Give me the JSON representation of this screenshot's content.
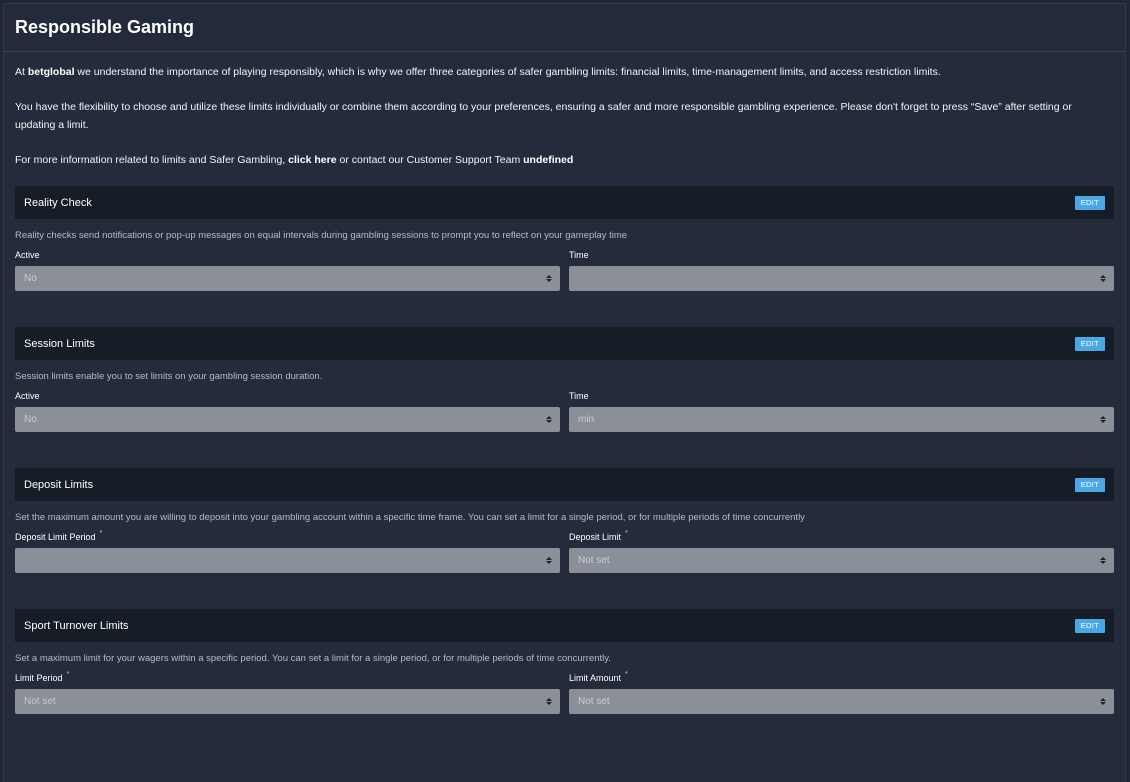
{
  "header": {
    "title": "Responsible Gaming"
  },
  "intro": {
    "p1_pre": "At ",
    "p1_brand": "betglobal",
    "p1_post": " we understand the importance of playing responsibly, which is why we offer three categories of safer gambling limits: financial limits, time-management limits, and access restriction limits.",
    "p2": "You have the flexibility to choose and utilize these limits individually or combine them according to your preferences, ensuring a safer and more responsible gambling experience. Please don't forget to press “Save” after setting or updating a limit.",
    "p3_pre": "For more information related to limits and Safer Gambling, ",
    "p3_link": "click here",
    "p3_mid": " or contact our Customer Support Team ",
    "p3_team": "undefined"
  },
  "sections": [
    {
      "title": "Reality Check",
      "edit_label": "EDIT",
      "description": "Reality checks send notifications or pop-up messages on equal intervals during gambling sessions to prompt you to reflect on your gameplay time",
      "fields": [
        {
          "label": "Active",
          "required": "",
          "value": "No"
        },
        {
          "label": "Time",
          "required": "",
          "value": ""
        }
      ]
    },
    {
      "title": "Session Limits",
      "edit_label": "EDIT",
      "description": "Session limits enable you to set limits on your gambling session duration.",
      "fields": [
        {
          "label": "Active",
          "required": "",
          "value": "No"
        },
        {
          "label": "Time",
          "required": "",
          "value": "min"
        }
      ]
    },
    {
      "title": "Deposit Limits",
      "edit_label": "EDIT",
      "description": "Set the maximum amount you are willing to deposit into your gambling account within a specific time frame. You can set a limit for a single period, or for multiple periods of time concurrently",
      "fields": [
        {
          "label": "Deposit Limit Period",
          "required": "*",
          "value": ""
        },
        {
          "label": "Deposit Limit",
          "required": "*",
          "value": "Not set"
        }
      ]
    },
    {
      "title": "Sport Turnover Limits",
      "edit_label": "EDIT",
      "description": "Set a maximum limit for your wagers within a specific period. You can set a limit for a single period, or for multiple periods of time concurrently.",
      "fields": [
        {
          "label": "Limit Period",
          "required": "*",
          "value": "Not set"
        },
        {
          "label": "Limit Amount",
          "required": "*",
          "value": "Not set"
        }
      ]
    }
  ],
  "icons": {
    "select_caret": "up-down-caret-icon"
  },
  "colors": {
    "accent": "#4aa8e6",
    "background": "#242c3b",
    "section_bar": "#161d26",
    "select_bg": "#8b9098"
  }
}
